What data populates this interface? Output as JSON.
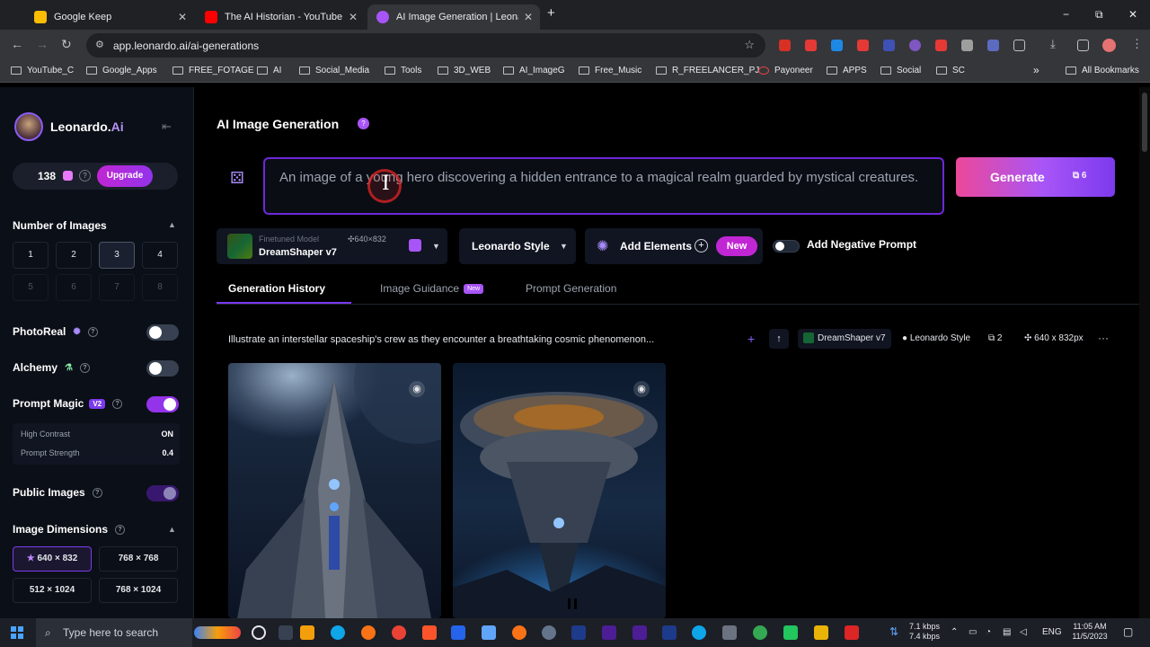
{
  "browser": {
    "tabs": [
      {
        "title": "Google Keep",
        "color": "#fbbc04"
      },
      {
        "title": "The AI Historian - YouTube",
        "color": "#ff0000"
      },
      {
        "title": "AI Image Generation | Leonard",
        "color": "#a855f7"
      }
    ],
    "new_tab": "+",
    "url": "app.leonardo.ai/ai-generations",
    "window_controls": {
      "minimize": "−",
      "maximize": "⧉",
      "close": "✕"
    },
    "bookmarks": [
      "YouTube_C",
      "Google_Apps",
      "FREE_FOTAGE",
      "AI",
      "Social_Media",
      "Tools",
      "3D_WEB",
      "AI_ImageG",
      "Free_Music",
      "R_FREELANCER_PJ",
      "Payoneer",
      "APPS",
      "Social",
      "SC"
    ],
    "bookmarks_more": "»",
    "all_bookmarks": "All Bookmarks"
  },
  "sidebar": {
    "brand": "Leonardo.",
    "brand_ai": "Ai",
    "collapse_icon": "⇤",
    "tokens": "138",
    "upgrade": "Upgrade",
    "num_images": {
      "title": "Number of Images",
      "options": [
        "1",
        "2",
        "3",
        "4",
        "5",
        "6",
        "7",
        "8"
      ],
      "selected": "3"
    },
    "photoreal": "PhotoReal",
    "alchemy": "Alchemy",
    "prompt_magic": "Prompt Magic",
    "prompt_magic_version": "V2",
    "high_contrast_label": "High Contrast",
    "high_contrast_value": "ON",
    "prompt_strength_label": "Prompt Strength",
    "prompt_strength_value": "0.4",
    "public_images": "Public Images",
    "image_dimensions": {
      "title": "Image Dimensions",
      "options": [
        "640 × 832",
        "768 × 768",
        "512 × 1024",
        "768 × 1024"
      ],
      "selected": "640 × 832",
      "star": "★"
    }
  },
  "main": {
    "title": "AI Image Generation",
    "prompt_text": "An image of a young hero discovering a hidden entrance to a magical realm guarded by mystical creatures.",
    "generate": "Generate",
    "generate_cost": "6",
    "model_sublabel": "Finetuned Model",
    "model_name": "DreamShaper v7",
    "model_res": "640×832",
    "style": "Leonardo Style",
    "add_elements": "Add Elements",
    "new_badge": "New",
    "negative_prompt": "Add Negative Prompt",
    "tabs": [
      "Generation History",
      "Image Guidance",
      "Prompt Generation"
    ],
    "tab_badge": "New",
    "history": {
      "prompt": "Illustrate an interstellar spaceship's crew as they encounter a breathtaking cosmic phenomenon...",
      "model": "DreamShaper v7",
      "style": "Leonardo Style",
      "count": "2",
      "dims": "640 x 832px",
      "more": "···"
    }
  },
  "taskbar": {
    "search_placeholder": "Type here to search",
    "net_up": "7.1 kbps",
    "net_down": "7.4 kbps",
    "lang": "ENG",
    "time": "11:05 AM",
    "date": "11/5/2023"
  }
}
